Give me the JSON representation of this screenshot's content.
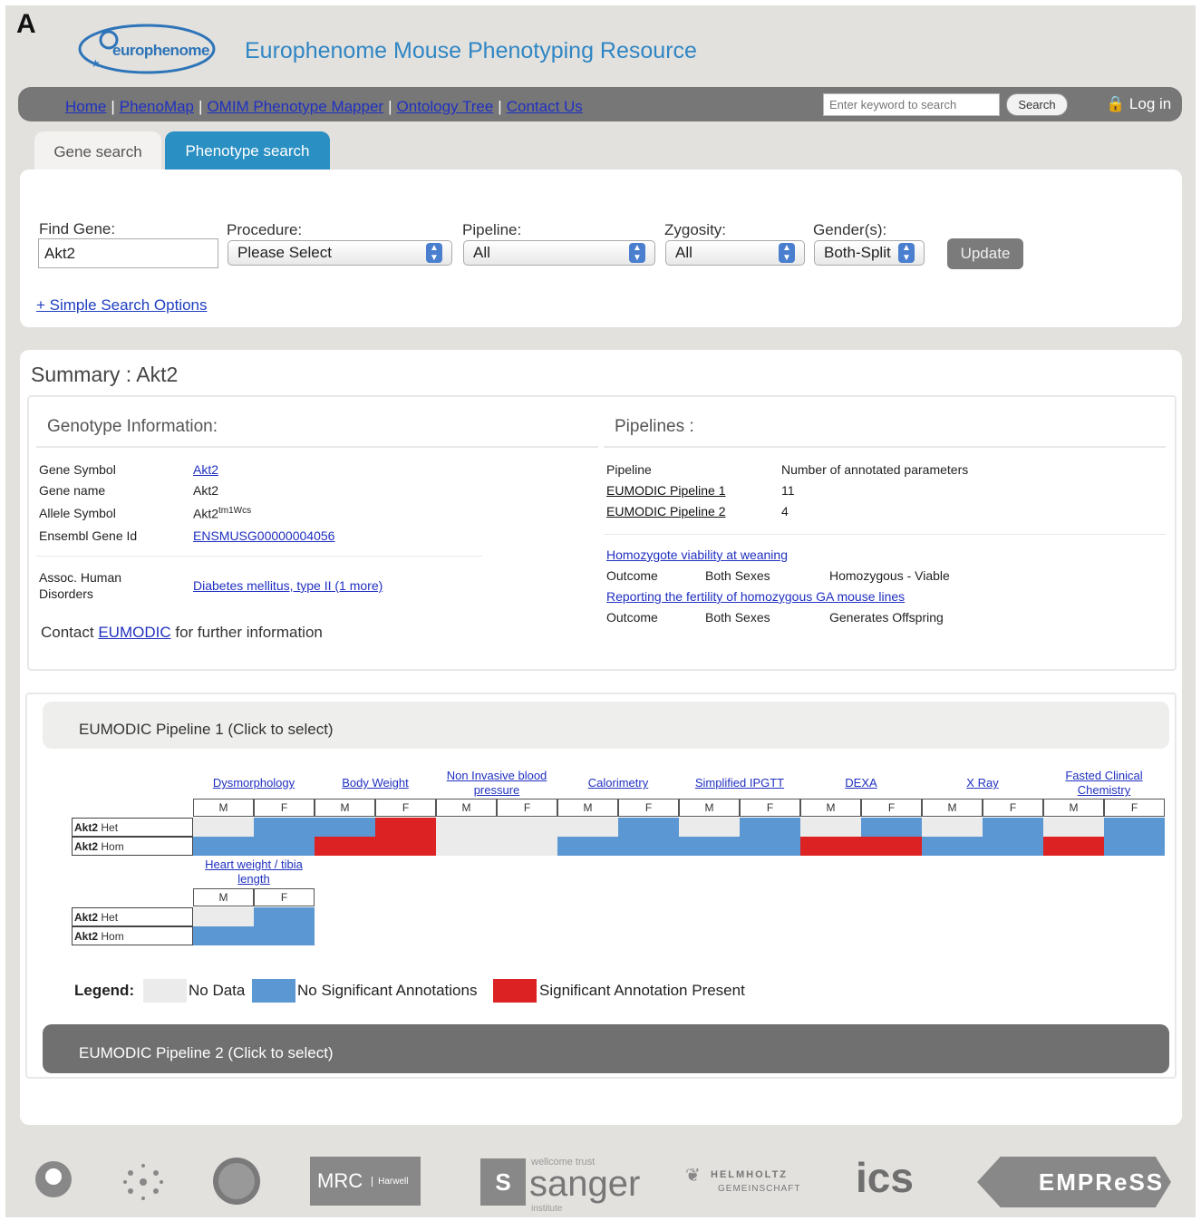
{
  "figure_letter": "A",
  "brand": {
    "logo_text": "europhenome",
    "site_title": "Europhenome Mouse Phenotyping Resource"
  },
  "nav": {
    "links": [
      "Home",
      "PhenoMap",
      "OMIM Phenotype Mapper",
      "Ontology Tree",
      "Contact Us"
    ],
    "search_placeholder": "Enter keyword to search",
    "search_button": "Search",
    "login": "Log in"
  },
  "tabs": {
    "gene": "Gene search",
    "phenotype": "Phenotype search"
  },
  "search": {
    "find_gene_label": "Find Gene:",
    "find_gene_value": "Akt2",
    "procedure_label": "Procedure:",
    "procedure_value": "Please Select",
    "pipeline_label": "Pipeline:",
    "pipeline_value": "All",
    "zygosity_label": "Zygosity:",
    "zygosity_value": "All",
    "gender_label": "Gender(s):",
    "gender_value": "Both-Split",
    "update_button": "Update",
    "simple_link": "+ Simple Search Options"
  },
  "summary": {
    "title": "Summary : Akt2",
    "genotype_header": "Genotype Information:",
    "pipelines_header": "Pipelines :",
    "gene_symbol_label": "Gene Symbol",
    "gene_symbol": "Akt2",
    "gene_name_label": "Gene name",
    "gene_name": "Akt2",
    "allele_symbol_label": "Allele Symbol",
    "allele_base": "Akt2",
    "allele_sup": "tm1Wcs",
    "ensembl_label": "Ensembl Gene Id",
    "ensembl_id": "ENSMUSG00000004056",
    "assoc_label_1": "Assoc. Human",
    "assoc_label_2": "Disorders",
    "assoc_value": "Diabetes mellitus, type II (1 more)",
    "contact_pre": "Contact",
    "contact_link": "EUMODIC",
    "contact_post": "for further information",
    "pipeline_col": "Pipeline",
    "params_col": "Number of annotated parameters",
    "pipelines": [
      {
        "name": "EUMODIC Pipeline 1",
        "count": "11"
      },
      {
        "name": "EUMODIC Pipeline 2",
        "count": "4"
      }
    ],
    "viability_link": "Homozygote viability at weaning",
    "fertility_link": "Reporting the fertility of homozygous GA mouse lines",
    "outcome_label": "Outcome",
    "both_sexes": "Both Sexes",
    "viability_result": "Homozygous - Viable",
    "fertility_result": "Generates Offspring"
  },
  "pipeline1": {
    "bar_label": "EUMODIC Pipeline 1 (Click to select)",
    "procedures": [
      "Dysmorphology",
      "Body Weight",
      "Non Invasive blood pressure",
      "Calorimetry",
      "Simplified IPGTT",
      "DEXA",
      "X Ray",
      "Fasted Clinical Chemistry"
    ],
    "procedures_row2": [
      "Heart weight / tibia length"
    ],
    "sex_m": "M",
    "sex_f": "F",
    "gene": "Akt2",
    "het": "Het",
    "hom": "Hom",
    "het_status": [
      [
        "nd",
        "ns"
      ],
      [
        "ns",
        "sg"
      ],
      [
        "nd",
        "nd"
      ],
      [
        "nd",
        "ns"
      ],
      [
        "nd",
        "ns"
      ],
      [
        "nd",
        "ns"
      ],
      [
        "nd",
        "ns"
      ],
      [
        "nd",
        "ns"
      ]
    ],
    "hom_status": [
      [
        "ns",
        "ns"
      ],
      [
        "sg",
        "sg"
      ],
      [
        "nd",
        "nd"
      ],
      [
        "ns",
        "ns"
      ],
      [
        "ns",
        "ns"
      ],
      [
        "sg",
        "sg"
      ],
      [
        "ns",
        "ns"
      ],
      [
        "sg",
        "ns"
      ]
    ],
    "row2_het_status": [
      [
        "nd",
        "ns"
      ]
    ],
    "row2_hom_status": [
      [
        "ns",
        "ns"
      ]
    ]
  },
  "legend": {
    "title": "Legend:",
    "no_data": "No Data",
    "no_sig": "No Significant Annotations",
    "sig": "Significant Annotation Present",
    "colors": {
      "nd": "#ebebeb",
      "ns": "#5b97d2",
      "sg": "#dc2222"
    }
  },
  "pipeline2": {
    "bar_label": "EUMODIC Pipeline 2 (Click to select)"
  },
  "footer": {
    "logo_labels": [
      "MRC",
      "Harwell",
      "wellcome trust",
      "sanger",
      "institute",
      "HELMHOLTZ",
      "GEMEINSCHAFT",
      "ics",
      "EMPReSS"
    ]
  }
}
